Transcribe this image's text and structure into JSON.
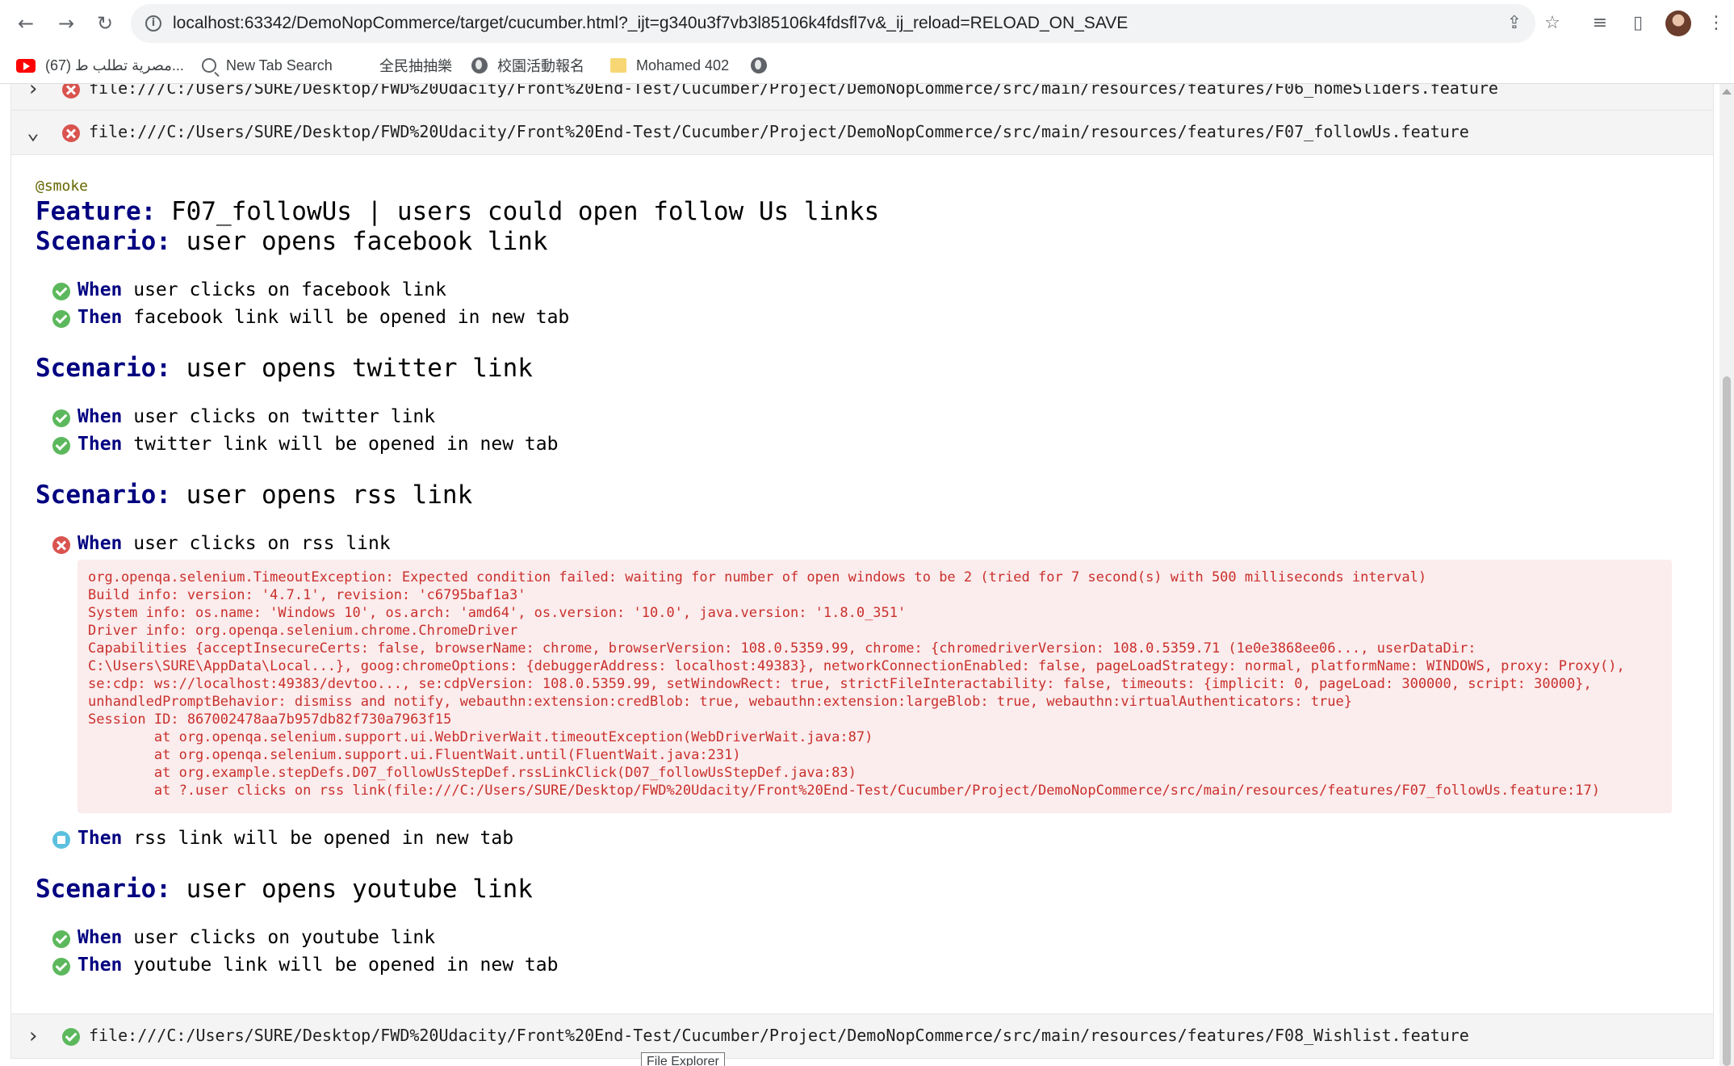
{
  "browser": {
    "url": "localhost:63342/DemoNopCommerce/target/cucumber.html?_ijt=g340u3f7vb3l85106k4fdsfl7v&_ij_reload=RELOAD_ON_SAVE",
    "nav": {
      "back": "←",
      "forward": "→",
      "reload": "↻"
    },
    "bookmarks": [
      {
        "label": "(67) مصرية تطلب ط...",
        "icon": "youtube-icon"
      },
      {
        "label": "New Tab Search",
        "icon": "search-icon"
      },
      {
        "label": "全民抽抽樂",
        "icon": "blank-icon"
      },
      {
        "label": "校園活動報名",
        "icon": "globe-icon"
      },
      {
        "label": "Mohamed 402",
        "icon": "folder-icon"
      },
      {
        "label": "",
        "icon": "globe-icon"
      }
    ]
  },
  "report": {
    "files": [
      {
        "path": "file:///C:/Users/SURE/Desktop/FWD%20Udacity/Front%20End-Test/Cucumber/Project/DemoNopCommerce/src/main/resources/features/F06_homeSliders.feature",
        "status": "failed",
        "expanded": false
      },
      {
        "path": "file:///C:/Users/SURE/Desktop/FWD%20Udacity/Front%20End-Test/Cucumber/Project/DemoNopCommerce/src/main/resources/features/F07_followUs.feature",
        "status": "failed",
        "expanded": true
      },
      {
        "path": "file:///C:/Users/SURE/Desktop/FWD%20Udacity/Front%20End-Test/Cucumber/Project/DemoNopCommerce/src/main/resources/features/F08_Wishlist.feature",
        "status": "passed",
        "expanded": false
      }
    ],
    "feature": {
      "tag": "@smoke",
      "keyword": "Feature:",
      "name": " F07_followUs | users could open follow Us links",
      "scenario_keyword": "Scenario:",
      "scenarios": [
        {
          "name": " user opens facebook link",
          "steps": [
            {
              "status": "passed",
              "keyword": "When",
              "text": " user clicks on facebook link"
            },
            {
              "status": "passed",
              "keyword": "Then",
              "text": " facebook link will be opened in new tab"
            }
          ]
        },
        {
          "name": " user opens twitter link",
          "steps": [
            {
              "status": "passed",
              "keyword": "When",
              "text": " user clicks on twitter link"
            },
            {
              "status": "passed",
              "keyword": "Then",
              "text": " twitter link will be opened in new tab"
            }
          ]
        },
        {
          "name": " user opens rss link",
          "steps": [
            {
              "status": "failed",
              "keyword": "When",
              "text": " user clicks on rss link"
            },
            {
              "status": "skipped",
              "keyword": "Then",
              "text": " rss link will be opened in new tab"
            }
          ]
        },
        {
          "name": " user opens youtube link",
          "steps": [
            {
              "status": "passed",
              "keyword": "When",
              "text": " user clicks on youtube link"
            },
            {
              "status": "passed",
              "keyword": "Then",
              "text": " youtube link will be opened in new tab"
            }
          ]
        }
      ],
      "error_lines": [
        "org.openqa.selenium.TimeoutException: Expected condition failed: waiting for number of open windows to be 2 (tried for 7 second(s) with 500 milliseconds interval)",
        "Build info: version: '4.7.1', revision: 'c6795baf1a3'",
        "System info: os.name: 'Windows 10', os.arch: 'amd64', os.version: '10.0', java.version: '1.8.0_351'",
        "Driver info: org.openqa.selenium.chrome.ChromeDriver",
        "Capabilities {acceptInsecureCerts: false, browserName: chrome, browserVersion: 108.0.5359.99, chrome: {chromedriverVersion: 108.0.5359.71 (1e0e3868ee06..., userDataDir:",
        "C:\\Users\\SURE\\AppData\\Local...}, goog:chromeOptions: {debuggerAddress: localhost:49383}, networkConnectionEnabled: false, pageLoadStrategy: normal, platformName: WINDOWS, proxy: Proxy(),",
        "se:cdp: ws://localhost:49383/devtoo..., se:cdpVersion: 108.0.5359.99, setWindowRect: true, strictFileInteractability: false, timeouts: {implicit: 0, pageLoad: 300000, script: 30000},",
        "unhandledPromptBehavior: dismiss and notify, webauthn:extension:credBlob: true, webauthn:extension:largeBlob: true, webauthn:virtualAuthenticators: true}",
        "Session ID: 867002478aa7b957db82f730a7963f15",
        "        at org.openqa.selenium.support.ui.WebDriverWait.timeoutException(WebDriverWait.java:87)",
        "        at org.openqa.selenium.support.ui.FluentWait.until(FluentWait.java:231)",
        "        at org.example.stepDefs.D07_followUsStepDef.rssLinkClick(D07_followUsStepDef.java:83)",
        "        at ?.user clicks on rss link(file:///C:/Users/SURE/Desktop/FWD%20Udacity/Front%20End-Test/Cucumber/Project/DemoNopCommerce/src/main/resources/features/F07_followUs.feature:17)"
      ]
    }
  },
  "tooltip": "File Explorer"
}
